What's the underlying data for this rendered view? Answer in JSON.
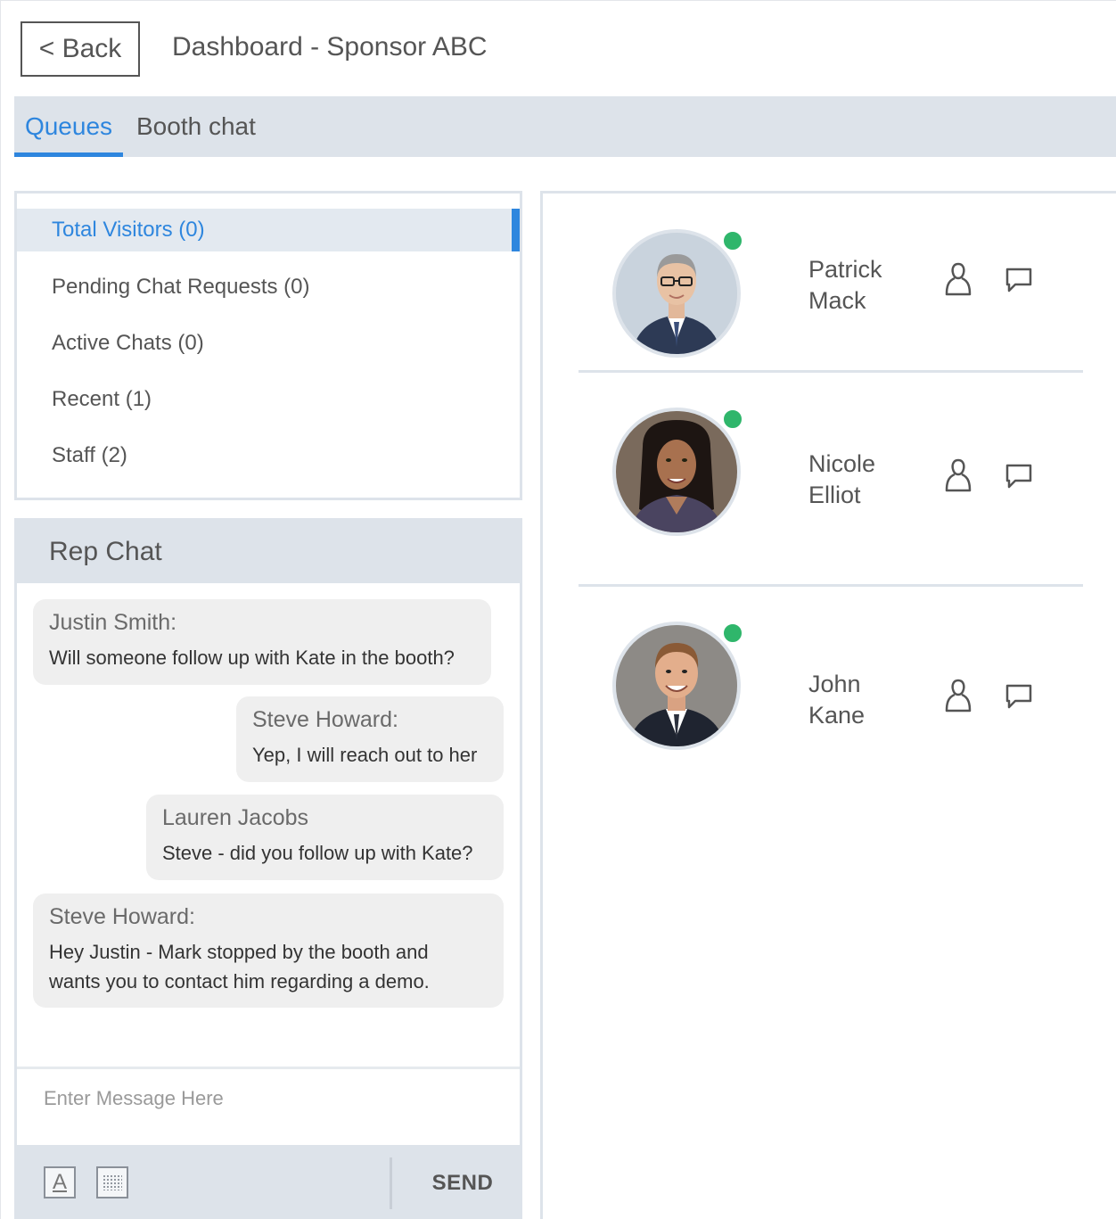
{
  "header": {
    "back_label": "< Back",
    "title": "Dashboard - Sponsor ABC"
  },
  "tabs": [
    {
      "label": "Queues",
      "active": true
    },
    {
      "label": "Booth chat",
      "active": false
    }
  ],
  "queues": [
    {
      "label": "Total Visitors  (0)",
      "active": true
    },
    {
      "label": "Pending Chat Requests  (0)",
      "active": false
    },
    {
      "label": "Active Chats  (0)",
      "active": false
    },
    {
      "label": "Recent  (1)",
      "active": false
    },
    {
      "label": "Staff  (2)",
      "active": false
    }
  ],
  "rep_chat": {
    "title": "Rep Chat",
    "messages": [
      {
        "sender": "Justin Smith:",
        "text": "Will someone follow up with Kate in the booth?"
      },
      {
        "sender": "Steve Howard:",
        "text": "Yep, I will reach out to her"
      },
      {
        "sender": "Lauren Jacobs",
        "text": "Steve - did you follow up with Kate?"
      },
      {
        "sender": "Steve Howard:",
        "text": "Hey Justin - Mark stopped by the booth and wants you to contact him regarding a demo."
      }
    ],
    "input_placeholder": "Enter Message Here",
    "send_label": "SEND",
    "toolbar_icons": [
      "font-format-icon",
      "emoji-grid-icon"
    ]
  },
  "staff": [
    {
      "first": "Patrick",
      "last": "Mack",
      "online": true
    },
    {
      "first": "Nicole",
      "last": "Elliot",
      "online": true
    },
    {
      "first": "John",
      "last": "Kane",
      "online": true
    }
  ],
  "colors": {
    "accent": "#2e86de",
    "online": "#2fb66b",
    "panel": "#dde3ea"
  }
}
